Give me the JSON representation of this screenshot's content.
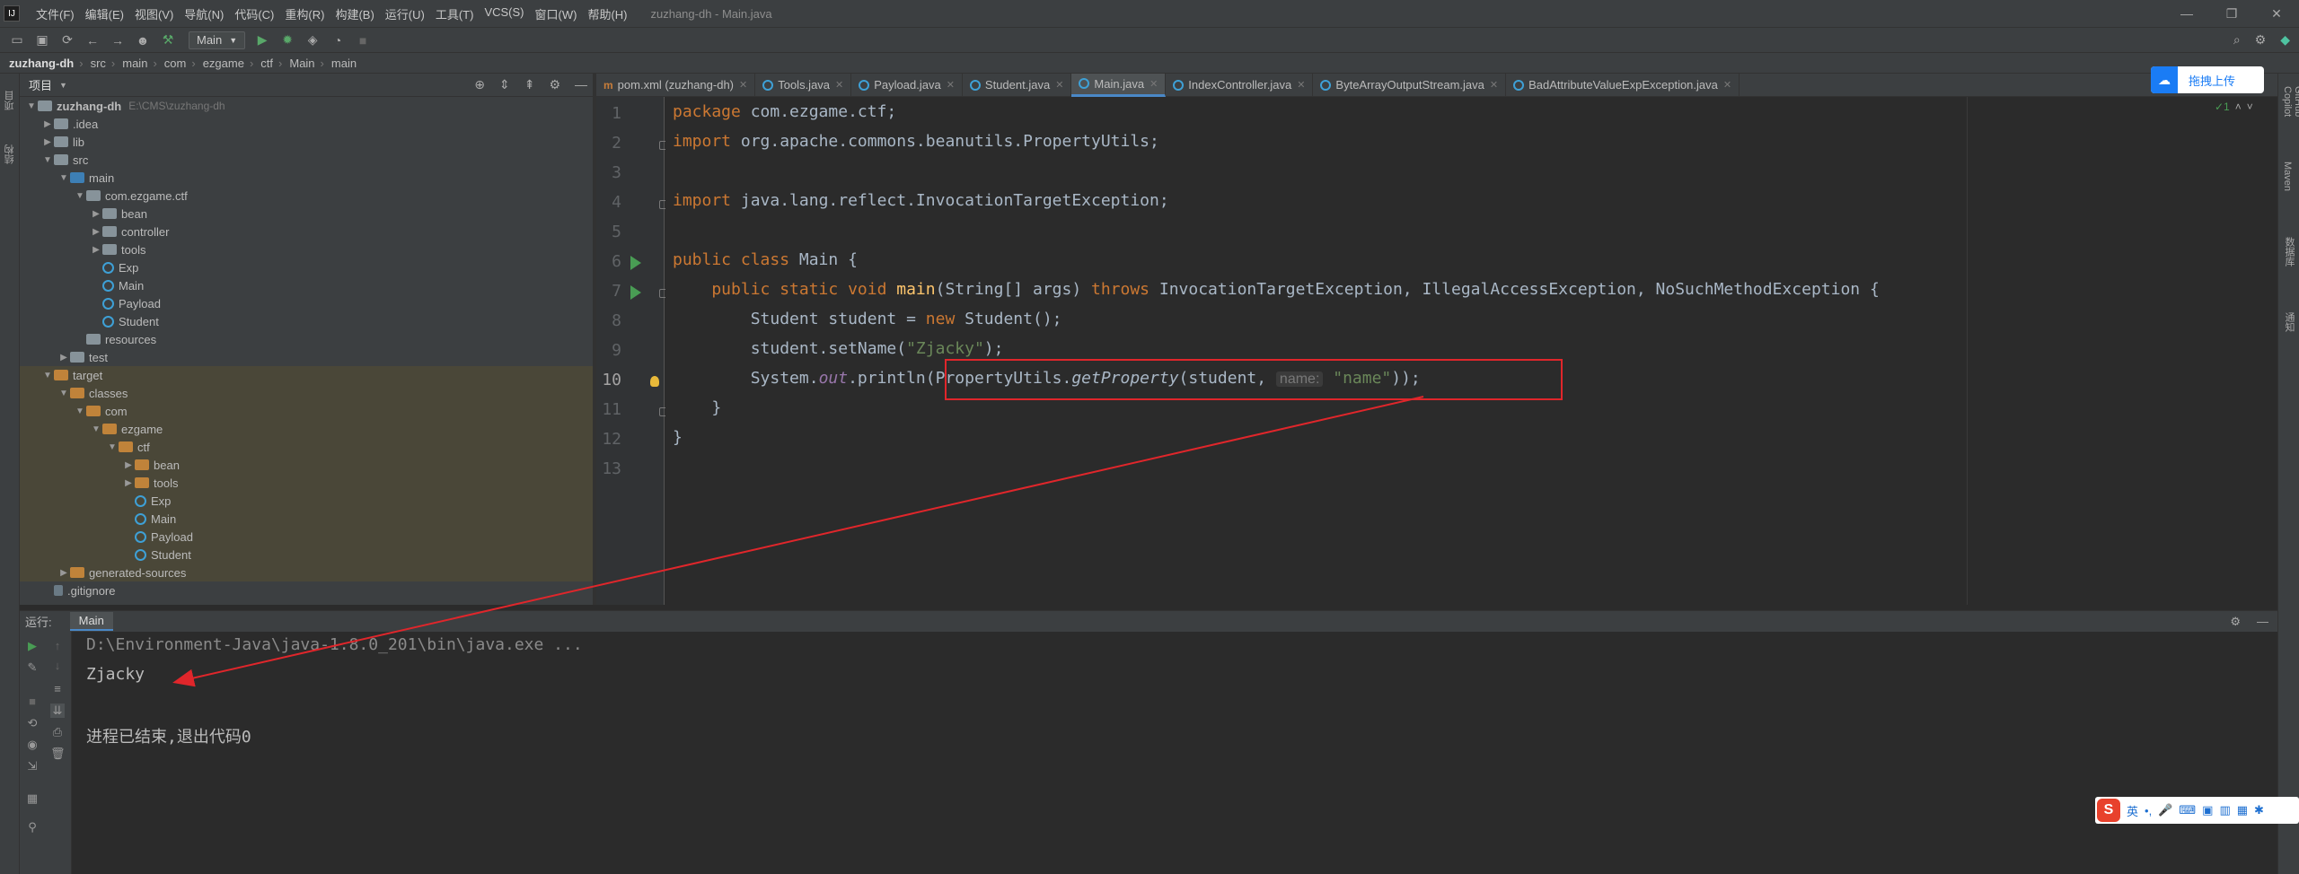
{
  "window": {
    "title": "zuzhang-dh - Main.java",
    "menu": [
      "文件(F)",
      "编辑(E)",
      "视图(V)",
      "导航(N)",
      "代码(C)",
      "重构(R)",
      "构建(B)",
      "运行(U)",
      "工具(T)",
      "VCS(S)",
      "窗口(W)",
      "帮助(H)"
    ],
    "run_config": "Main"
  },
  "breadcrumb": [
    "zuzhang-dh",
    "src",
    "main",
    "com",
    "ezgame",
    "ctf",
    "Main",
    "main"
  ],
  "left_stripe": [
    "项目",
    "结构"
  ],
  "project_panel": {
    "title": "项目",
    "tree": [
      {
        "label": "zuzhang-dh",
        "extra": "E:\\CMS\\zuzhang-dh",
        "depth": 0,
        "arrow": "open",
        "icon": "folder"
      },
      {
        "label": ".idea",
        "depth": 1,
        "arrow": "closed",
        "icon": "folder"
      },
      {
        "label": "lib",
        "depth": 1,
        "arrow": "closed",
        "icon": "folder"
      },
      {
        "label": "src",
        "depth": 1,
        "arrow": "open",
        "icon": "folder"
      },
      {
        "label": "main",
        "depth": 2,
        "arrow": "open",
        "icon": "blue"
      },
      {
        "label": "com.ezgame.ctf",
        "depth": 3,
        "arrow": "open",
        "icon": "folder"
      },
      {
        "label": "bean",
        "depth": 4,
        "arrow": "closed",
        "icon": "folder"
      },
      {
        "label": "controller",
        "depth": 4,
        "arrow": "closed",
        "icon": "folder"
      },
      {
        "label": "tools",
        "depth": 4,
        "arrow": "closed",
        "icon": "folder"
      },
      {
        "label": "Exp",
        "depth": 4,
        "arrow": "none",
        "icon": "cls"
      },
      {
        "label": "Main",
        "depth": 4,
        "arrow": "none",
        "icon": "cls"
      },
      {
        "label": "Payload",
        "depth": 4,
        "arrow": "none",
        "icon": "cls"
      },
      {
        "label": "Student",
        "depth": 4,
        "arrow": "none",
        "icon": "cls"
      },
      {
        "label": "resources",
        "depth": 3,
        "arrow": "none",
        "icon": "folder"
      },
      {
        "label": "test",
        "depth": 2,
        "arrow": "closed",
        "icon": "folder"
      },
      {
        "label": "target",
        "depth": 1,
        "arrow": "open",
        "icon": "orange",
        "hl": true
      },
      {
        "label": "classes",
        "depth": 2,
        "arrow": "open",
        "icon": "orange",
        "hl": true
      },
      {
        "label": "com",
        "depth": 3,
        "arrow": "open",
        "icon": "orange",
        "hl": true
      },
      {
        "label": "ezgame",
        "depth": 4,
        "arrow": "open",
        "icon": "orange",
        "hl": true
      },
      {
        "label": "ctf",
        "depth": 5,
        "arrow": "open",
        "icon": "orange",
        "hl": true
      },
      {
        "label": "bean",
        "depth": 6,
        "arrow": "closed",
        "icon": "orange",
        "hl": true
      },
      {
        "label": "tools",
        "depth": 6,
        "arrow": "closed",
        "icon": "orange",
        "hl": true
      },
      {
        "label": "Exp",
        "depth": 6,
        "arrow": "none",
        "icon": "cls",
        "hl": true
      },
      {
        "label": "Main",
        "depth": 6,
        "arrow": "none",
        "icon": "cls",
        "hl": true
      },
      {
        "label": "Payload",
        "depth": 6,
        "arrow": "none",
        "icon": "cls",
        "hl": true
      },
      {
        "label": "Student",
        "depth": 6,
        "arrow": "none",
        "icon": "cls",
        "hl": true
      },
      {
        "label": "generated-sources",
        "depth": 2,
        "arrow": "closed",
        "icon": "orange",
        "hl": true
      },
      {
        "label": ".gitignore",
        "depth": 1,
        "arrow": "none",
        "icon": "file"
      }
    ]
  },
  "tabs": [
    {
      "label": "pom.xml (zuzhang-dh)",
      "icon": "m"
    },
    {
      "label": "Tools.java",
      "icon": "c"
    },
    {
      "label": "Payload.java",
      "icon": "c"
    },
    {
      "label": "Student.java",
      "icon": "c"
    },
    {
      "label": "Main.java",
      "icon": "c",
      "active": true
    },
    {
      "label": "IndexController.java",
      "icon": "c"
    },
    {
      "label": "ByteArrayOutputStream.java",
      "icon": "c"
    },
    {
      "label": "BadAttributeValueExpException.java",
      "icon": "c"
    }
  ],
  "editor": {
    "line_numbers": [
      "1",
      "2",
      "3",
      "4",
      "5",
      "6",
      "7",
      "8",
      "9",
      "10",
      "11",
      "12",
      "13"
    ],
    "current_line": "10",
    "inspection": "✓1",
    "code": {
      "l1_kw": "package",
      "l1_rest": " com.ezgame.ctf;",
      "l2_kw": "import",
      "l2_rest": " org.apache.commons.beanutils.PropertyUtils;",
      "l4_kw": "import",
      "l4_rest": " java.lang.reflect.InvocationTargetException;",
      "l6_kw": "public class",
      "l6_rest": " Main {",
      "l7_kw1": "    public static void",
      "l7_fn": " main",
      "l7_mid": "(String[] args) ",
      "l7_kw2": "throws",
      "l7_rest": " InvocationTargetException, IllegalAccessException, NoSuchMethodException {",
      "l8_pre": "        Student student = ",
      "l8_kw": "new",
      "l8_rest": " Student();",
      "l9_pre": "        student.setName(",
      "l9_str": "\"Zjacky\"",
      "l9_rest": ");",
      "l10_pre": "        System.",
      "l10_st": "out",
      "l10_mid": ".println(PropertyUtils.",
      "l10_it": "getProperty",
      "l10_args": "(student, ",
      "l10_hint": "name:",
      "l10_str": " \"name\"",
      "l10_rest": "));",
      "l11": "    }",
      "l12": "}"
    }
  },
  "upload_button": "拖拽上传",
  "right_stripe": [
    "GitHub Copilot",
    "Maven",
    "数据库",
    "通知"
  ],
  "run_panel": {
    "label": "运行:",
    "tab": "Main",
    "lines": [
      "D:\\Environment-Java\\java-1.8.0_201\\bin\\java.exe ...",
      "Zjacky",
      "",
      "进程已结束,退出代码0"
    ]
  },
  "ime": {
    "mode": "英"
  },
  "colors": {
    "keyword": "#cc7832",
    "string": "#6a8759",
    "method": "#ffc66d",
    "static_field": "#9876aa",
    "annotation_red": "#e0262b"
  }
}
